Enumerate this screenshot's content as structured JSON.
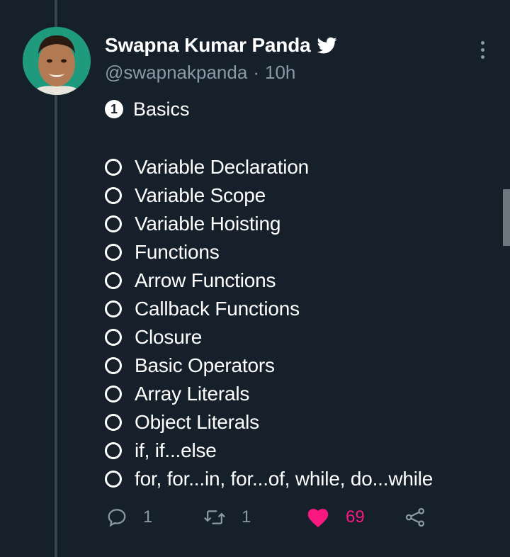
{
  "tweet": {
    "author_name": "Swapna Kumar Panda",
    "handle": "@swapnakpanda",
    "separator": "·",
    "time": "10h",
    "section_number": "1",
    "section_title": "Basics",
    "items": [
      "Variable Declaration",
      "Variable Scope",
      "Variable Hoisting",
      "Functions",
      "Arrow Functions",
      "Callback Functions",
      "Closure",
      "Basic Operators",
      "Array Literals",
      "Object Literals",
      "if, if...else",
      "for, for...in, for...of, while, do...while"
    ]
  },
  "actions": {
    "reply_count": "1",
    "retweet_count": "1",
    "like_count": "69"
  },
  "colors": {
    "background": "#15202b",
    "text_primary": "#ffffff",
    "text_secondary": "#8b98a5",
    "like": "#f91880",
    "thread_line": "#38444d"
  },
  "icons": {
    "verified": "twitter-bird-icon",
    "more": "more-vertical-icon",
    "reply": "reply-icon",
    "retweet": "retweet-icon",
    "like": "heart-icon",
    "share": "share-icon"
  }
}
